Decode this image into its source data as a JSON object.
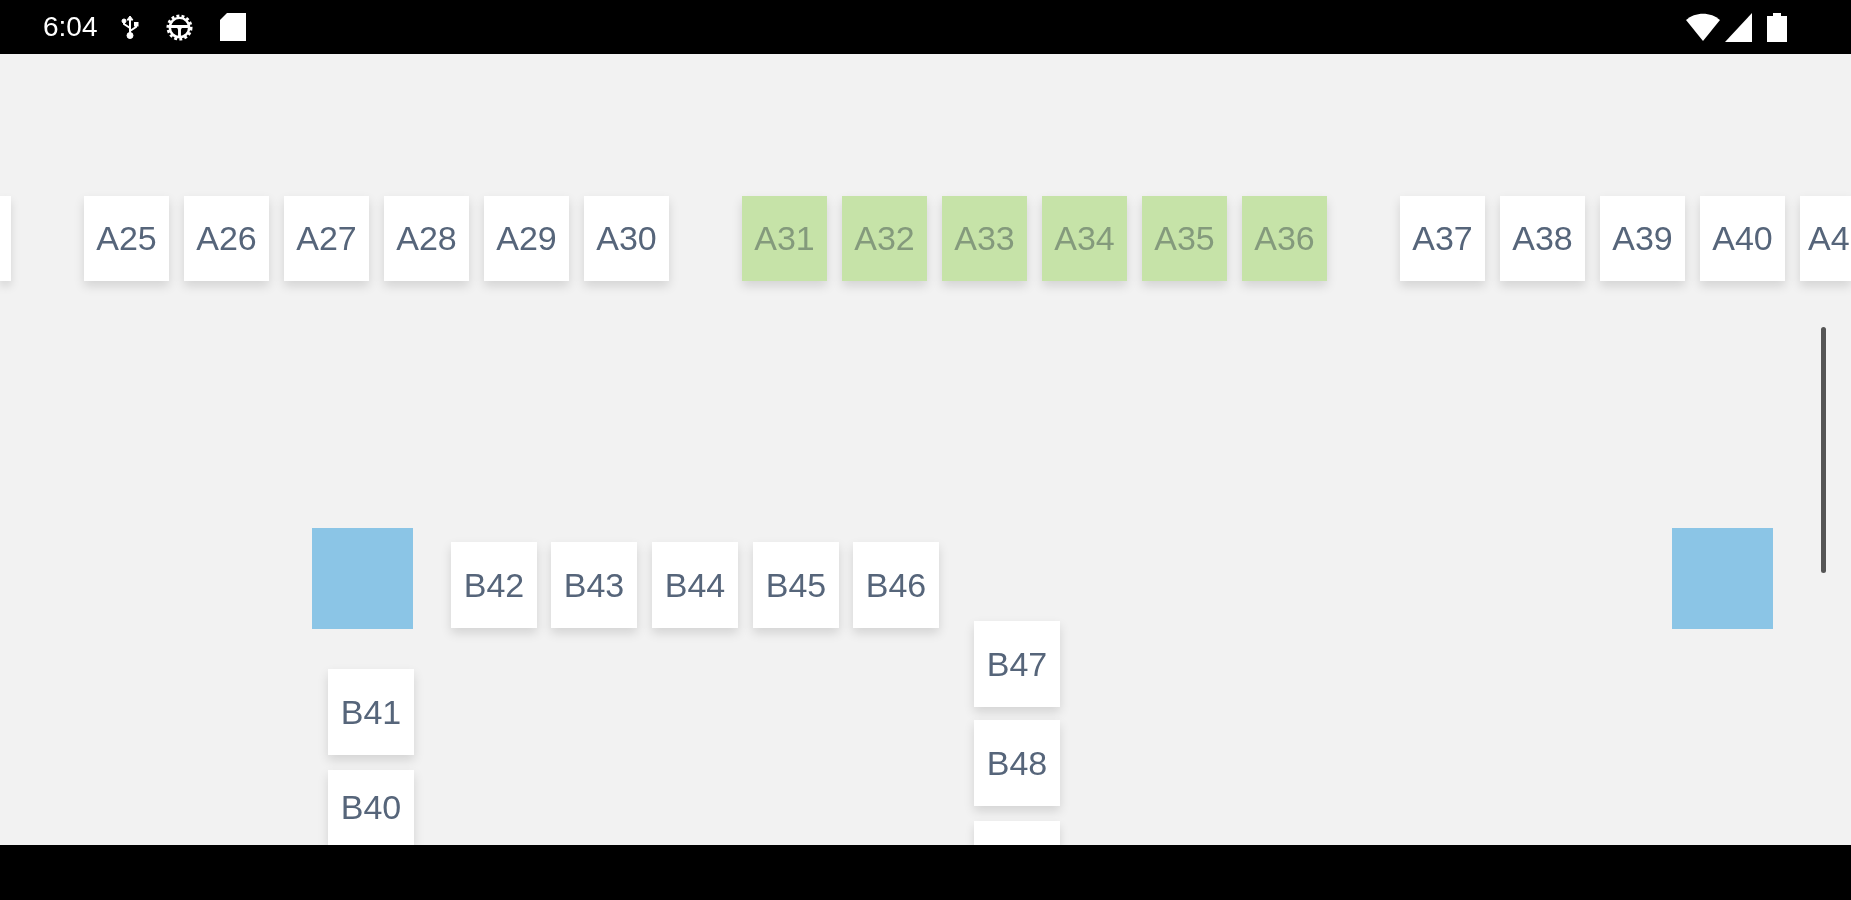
{
  "status_bar": {
    "time": "6:04"
  },
  "seat_map": {
    "items": [
      {
        "kind": "seat",
        "selected": false
      },
      {
        "kind": "seat",
        "label": "A25",
        "selected": false
      },
      {
        "kind": "seat",
        "label": "A26",
        "selected": false
      },
      {
        "kind": "seat",
        "label": "A27",
        "selected": false
      },
      {
        "kind": "seat",
        "label": "A28",
        "selected": false
      },
      {
        "kind": "seat",
        "label": "A29",
        "selected": false
      },
      {
        "kind": "seat",
        "label": "A30",
        "selected": false
      },
      {
        "kind": "seat",
        "label": "A31",
        "selected": true
      },
      {
        "kind": "seat",
        "label": "A32",
        "selected": true
      },
      {
        "kind": "seat",
        "label": "A33",
        "selected": true
      },
      {
        "kind": "seat",
        "label": "A34",
        "selected": true
      },
      {
        "kind": "seat",
        "label": "A35",
        "selected": true
      },
      {
        "kind": "seat",
        "label": "A36",
        "selected": true
      },
      {
        "kind": "seat",
        "label": "A37",
        "selected": false
      },
      {
        "kind": "seat",
        "label": "A38",
        "selected": false
      },
      {
        "kind": "seat",
        "label": "A39",
        "selected": false
      },
      {
        "kind": "seat",
        "label": "A40",
        "selected": false
      },
      {
        "kind": "seat",
        "label": "A4",
        "selected": false
      },
      {
        "kind": "block"
      },
      {
        "kind": "seat",
        "label": "B42",
        "selected": false
      },
      {
        "kind": "seat",
        "label": "B43",
        "selected": false
      },
      {
        "kind": "seat",
        "label": "B44",
        "selected": false
      },
      {
        "kind": "seat",
        "label": "B45",
        "selected": false
      },
      {
        "kind": "seat",
        "label": "B46",
        "selected": false
      },
      {
        "kind": "block"
      },
      {
        "kind": "seat",
        "label": "B47",
        "selected": false
      },
      {
        "kind": "seat",
        "label": "B41",
        "selected": false
      },
      {
        "kind": "seat",
        "label": "B48",
        "selected": false
      },
      {
        "kind": "seat",
        "label": "B40",
        "selected": false
      },
      {
        "kind": "seat",
        "selected": false
      }
    ]
  }
}
